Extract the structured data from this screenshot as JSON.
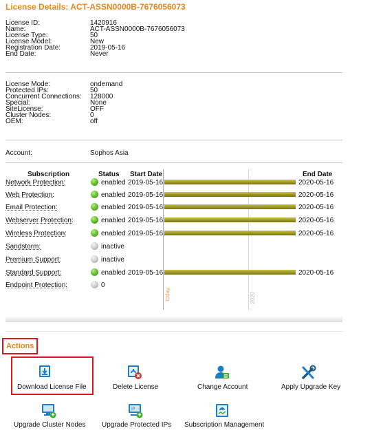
{
  "title": "License Details: ACT-ASSN0000B-7676056073",
  "license": [
    {
      "label": "License ID:",
      "value": "1420916"
    },
    {
      "label": "Name:",
      "value": "ACT-ASSN0000B-7676056073"
    },
    {
      "label": "License Type:",
      "value": "50"
    },
    {
      "label": "License Model:",
      "value": "New"
    },
    {
      "label": "Registration Date:",
      "value": "2019-05-16"
    },
    {
      "label": "End Date:",
      "value": "Never"
    }
  ],
  "mode": [
    {
      "label": "License Mode:",
      "value": "ondemand"
    },
    {
      "label": "Protected IPs:",
      "value": "50"
    },
    {
      "label": "Concurrent Connections:",
      "value": "128000"
    },
    {
      "label": "Special:",
      "value": "None"
    },
    {
      "label": "SiteLicense:",
      "value": "OFF"
    },
    {
      "label": "Cluster Nodes:",
      "value": "0"
    },
    {
      "label": "OEM:",
      "value": "off"
    }
  ],
  "account": {
    "label": "Account:",
    "value": "Sophos Asia"
  },
  "subscription_headers": {
    "subscription": "Subscription",
    "status": "Status",
    "start": "Start Date",
    "end": "End Date"
  },
  "subscriptions": [
    {
      "name": "Network Protection:",
      "status": "enabled",
      "state": "enabled",
      "start": "2019-05-16",
      "end": "2020-05-16"
    },
    {
      "name": "Web Protection:",
      "status": "enabled",
      "state": "enabled",
      "start": "2019-05-16",
      "end": "2020-05-16"
    },
    {
      "name": "Email Protection:",
      "status": "enabled",
      "state": "enabled",
      "start": "2019-05-16",
      "end": "2020-05-16"
    },
    {
      "name": "Webserver Protection:",
      "status": "enabled",
      "state": "enabled",
      "start": "2019-05-16",
      "end": "2020-05-16"
    },
    {
      "name": "Wireless Protection:",
      "status": "enabled",
      "state": "enabled",
      "start": "2019-05-16",
      "end": "2020-05-16"
    },
    {
      "name": "Sandstorm:",
      "status": "inactive",
      "state": "inactive",
      "start": "",
      "end": ""
    },
    {
      "name": "Premium Support:",
      "status": "inactive",
      "state": "inactive",
      "start": "",
      "end": ""
    },
    {
      "name": "Standard Support:",
      "status": "enabled",
      "state": "enabled",
      "start": "2019-05-16",
      "end": "2020-05-16"
    },
    {
      "name": "Endpoint Protection:",
      "status": "0",
      "state": "inactive",
      "start": "",
      "end": ""
    }
  ],
  "timeline": {
    "today_label": "today",
    "year_label": "2020",
    "today_color": "#f0a040",
    "year_color": "#d8d8d8"
  },
  "actions_title": "Actions",
  "actions": [
    {
      "label": "Download License File",
      "icon": "download-license-icon"
    },
    {
      "label": "Delete License",
      "icon": "delete-license-icon"
    },
    {
      "label": "Change Account",
      "icon": "change-account-icon"
    },
    {
      "label": "Apply Upgrade Key",
      "icon": "upgrade-key-icon"
    },
    {
      "label": "Upgrade Cluster Nodes",
      "icon": "cluster-nodes-icon"
    },
    {
      "label": "Upgrade Protected IPs",
      "icon": "protected-ips-icon"
    },
    {
      "label": "Subscription Management",
      "icon": "subscription-management-icon"
    }
  ],
  "colors": {
    "accent": "#e8861a",
    "highlight": "#e0161c",
    "icon_blue": "#1e7fc6",
    "icon_green": "#3fae2a",
    "bar": "#8f8712"
  }
}
